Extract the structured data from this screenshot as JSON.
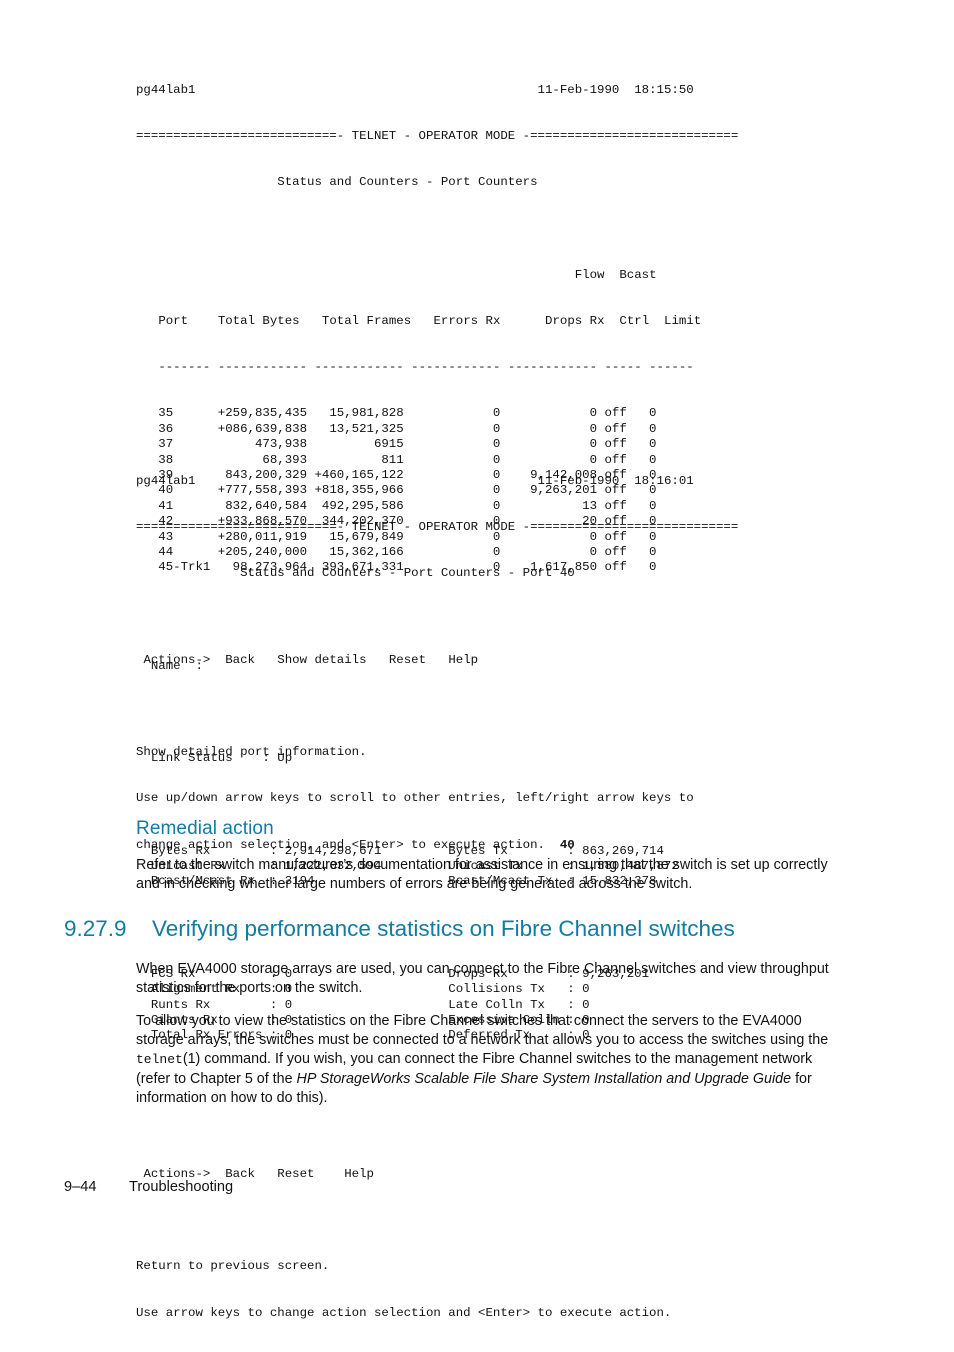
{
  "colors": {
    "heading_teal": "#127ba3",
    "body_text": "#111111",
    "page_background": "#ffffff"
  },
  "terminal_screen_1": {
    "host": "pg44lab1",
    "date": "11-Feb-1990",
    "time": "18:15:50",
    "banner": "===========================- TELNET - OPERATOR MODE -============================",
    "subtitle": "Status and Counters - Port Counters",
    "table": {
      "header_top": [
        "",
        "",
        "",
        "",
        "",
        "Flow",
        "Bcast"
      ],
      "headers": [
        "Port",
        "Total Bytes",
        "Total Frames",
        "Errors Rx",
        "Drops Rx",
        "Ctrl",
        "Limit"
      ],
      "separators": [
        "-------",
        "------------",
        "------------",
        "------------",
        "------------",
        "-----",
        "------"
      ],
      "rows": [
        {
          "port": "35",
          "total_bytes": "+259,835,435",
          "total_frames": "15,981,828",
          "errors_rx": "0",
          "drops_rx": "0",
          "flow_ctrl": "off",
          "bcast_limit": "0"
        },
        {
          "port": "36",
          "total_bytes": "+086,639,838",
          "total_frames": "13,521,325",
          "errors_rx": "0",
          "drops_rx": "0",
          "flow_ctrl": "off",
          "bcast_limit": "0"
        },
        {
          "port": "37",
          "total_bytes": "473,938",
          "total_frames": "6915",
          "errors_rx": "0",
          "drops_rx": "0",
          "flow_ctrl": "off",
          "bcast_limit": "0"
        },
        {
          "port": "38",
          "total_bytes": "68,393",
          "total_frames": "811",
          "errors_rx": "0",
          "drops_rx": "0",
          "flow_ctrl": "off",
          "bcast_limit": "0"
        },
        {
          "port": "39",
          "total_bytes": "843,200,329",
          "total_frames": "+460,165,122",
          "errors_rx": "0",
          "drops_rx": "9,142,008",
          "flow_ctrl": "off",
          "bcast_limit": "0"
        },
        {
          "port": "40",
          "total_bytes": "+777,558,393",
          "total_frames": "+818,355,966",
          "errors_rx": "0",
          "drops_rx": "9,263,201",
          "flow_ctrl": "off",
          "bcast_limit": "0"
        },
        {
          "port": "41",
          "total_bytes": "832,640,584",
          "total_frames": "492,295,586",
          "errors_rx": "0",
          "drops_rx": "13",
          "flow_ctrl": "off",
          "bcast_limit": "0"
        },
        {
          "port": "42",
          "total_bytes": "+933,868,570",
          "total_frames": "344,202,370",
          "errors_rx": "0",
          "drops_rx": "20",
          "flow_ctrl": "off",
          "bcast_limit": "0"
        },
        {
          "port": "43",
          "total_bytes": "+280,011,919",
          "total_frames": "15,679,849",
          "errors_rx": "0",
          "drops_rx": "0",
          "flow_ctrl": "off",
          "bcast_limit": "0"
        },
        {
          "port": "44",
          "total_bytes": "+205,240,000",
          "total_frames": "15,362,166",
          "errors_rx": "0",
          "drops_rx": "0",
          "flow_ctrl": "off",
          "bcast_limit": "0"
        },
        {
          "port": "45-Trk1",
          "total_bytes": "98,273,964",
          "total_frames": "393,671,331",
          "errors_rx": "0",
          "drops_rx": "1,617,850",
          "flow_ctrl": "off",
          "bcast_limit": "0"
        }
      ]
    },
    "actions": {
      "prompt": "Actions->",
      "items": [
        "Back",
        "Show details",
        "Reset",
        "Help"
      ]
    },
    "help_line_1": "Show detailed port information.",
    "help_line_2": "Use up/down arrow keys to scroll to other entries, left/right arrow keys to",
    "help_line_3": "change action selection, and <Enter> to execute action.",
    "selected_port": "40"
  },
  "terminal_screen_2": {
    "host": "pg44lab1",
    "date": "11-Feb-1990",
    "time": "18:16:01",
    "banner": "===========================- TELNET - OPERATOR MODE -============================",
    "subtitle": "Status and Counters - Port Counters - Port 40",
    "name_label": "Name",
    "name_value": "",
    "link_status_label": "Link Status",
    "link_status_value": "Up",
    "stats_group_1": [
      {
        "left_label": "Bytes Rx",
        "left_value": "2,914,298,671",
        "right_label": "Bytes Tx",
        "right_value": "863,269,714"
      },
      {
        "left_label": "Unicast Rx",
        "left_value": "1,222,032,594",
        "right_label": "Unicast Tx",
        "right_value": "1,580,487,872"
      },
      {
        "left_label": "Bcast/Mcast Rx",
        "left_value": "3194",
        "right_label": "Bcast/Mcast Tx",
        "right_value": "15,832,378"
      }
    ],
    "stats_group_2": [
      {
        "left_label": "FCS Rx",
        "left_value": "0",
        "right_label": "Drops Rx",
        "right_value": "9,263,201"
      },
      {
        "left_label": "Alignment Rx",
        "left_value": "0",
        "right_label": "Collisions Tx",
        "right_value": "0"
      },
      {
        "left_label": "Runts Rx",
        "left_value": "0",
        "right_label": "Late Colln Tx",
        "right_value": "0"
      },
      {
        "left_label": "Giants Rx",
        "left_value": "0",
        "right_label": "Excessive Colln",
        "right_value": "0"
      },
      {
        "left_label": "Total Rx Errors",
        "left_value": "0",
        "right_label": "Deferred Tx",
        "right_value": "0"
      }
    ],
    "actions": {
      "prompt": "Actions->",
      "items": [
        "Back",
        "Reset",
        "Help"
      ]
    },
    "help_line_1": "Return to previous screen.",
    "help_line_2": "Use arrow keys to change action selection and <Enter> to execute action."
  },
  "remedial": {
    "heading": "Remedial action",
    "paragraph": "Refer to the switch manufacturer’s documentation for assistance in ensuring that the switch is set up correctly and in checking whether large numbers of errors are being generated across the switch."
  },
  "section": {
    "number": "9.27.9",
    "title": "Verifying performance statistics on Fibre Channel switches"
  },
  "body": {
    "paragraph_1": "When EVA4000 storage arrays are used, you can connect to the Fibre Channel switches and view throughput statistics for the ports on the switch.",
    "paragraph_2_part_1": "To allow you to view the statistics on the Fibre Channel switches that connect the servers to the EVA4000 storage arrays, the switches must be connected to a network that allows you to access the switches using the ",
    "paragraph_2_mono": "telnet",
    "paragraph_2_part_2": "(1) command. If you wish, you can connect the Fibre Channel switches to the management network (refer to Chapter 5 of the ",
    "paragraph_2_italic": "HP StorageWorks Scalable File Share System Installation and Upgrade Guide",
    "paragraph_2_part_3": " for information on how to do this)."
  },
  "footer": {
    "page_number": "9–44",
    "chapter_title": "Troubleshooting"
  }
}
